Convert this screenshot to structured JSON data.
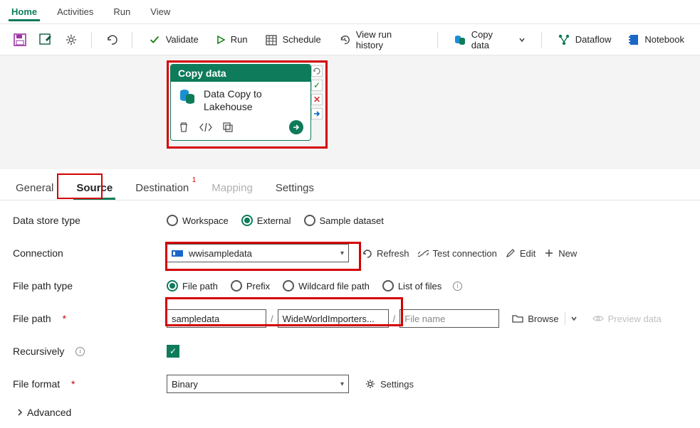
{
  "menu": {
    "home": "Home",
    "activities": "Activities",
    "run": "Run",
    "view": "View"
  },
  "toolbar": {
    "validate": "Validate",
    "run": "Run",
    "schedule": "Schedule",
    "view_history": "View run history",
    "copy_data": "Copy data",
    "dataflow": "Dataflow",
    "notebook": "Notebook"
  },
  "node": {
    "header": "Copy data",
    "title_line1": "Data Copy to",
    "title_line2": "Lakehouse"
  },
  "tabs": {
    "general": "General",
    "source": "Source",
    "destination": "Destination",
    "mapping": "Mapping",
    "settings": "Settings",
    "destination_badge": "1"
  },
  "form": {
    "data_store_type": {
      "label": "Data store type",
      "workspace": "Workspace",
      "external": "External",
      "sample": "Sample dataset",
      "selected": "external"
    },
    "connection": {
      "label": "Connection",
      "value": "wwisampledata",
      "refresh": "Refresh",
      "test": "Test connection",
      "edit": "Edit",
      "new": "New"
    },
    "file_path_type": {
      "label": "File path type",
      "filepath": "File path",
      "prefix": "Prefix",
      "wildcard": "Wildcard file path",
      "list": "List of files",
      "selected": "filepath"
    },
    "file_path": {
      "label": "File path",
      "container": "sampledata",
      "directory": "WideWorldImporters...",
      "file_placeholder": "File name",
      "browse": "Browse",
      "preview": "Preview data"
    },
    "recursively": {
      "label": "Recursively",
      "checked": true
    },
    "file_format": {
      "label": "File format",
      "value": "Binary",
      "settings": "Settings"
    },
    "advanced": "Advanced"
  }
}
